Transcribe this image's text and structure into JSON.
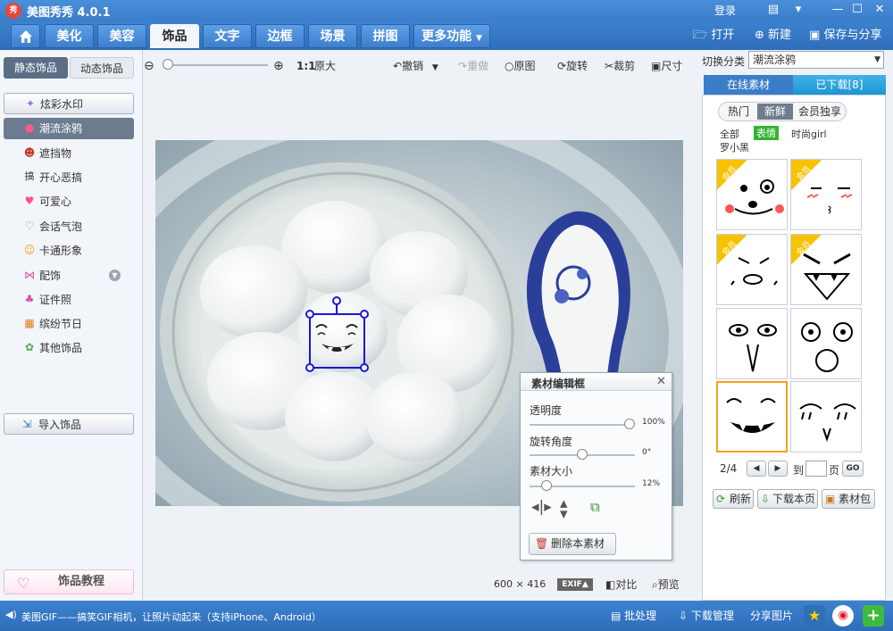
{
  "app": {
    "logo": "秀",
    "title": "美图秀秀 4.0.1",
    "login": "登录"
  },
  "tabs": [
    {
      "label": "美化"
    },
    {
      "label": "美容"
    },
    {
      "label": "饰品"
    },
    {
      "label": "文字"
    },
    {
      "label": "边框"
    },
    {
      "label": "场景"
    },
    {
      "label": "拼图"
    },
    {
      "label": "更多功能"
    }
  ],
  "top_actions": {
    "open": "打开",
    "new": "新建",
    "save": "保存与分享"
  },
  "left": {
    "subtabs": [
      "静态饰品",
      "动态饰品"
    ],
    "items": [
      {
        "label": "炫彩水印"
      },
      {
        "label": "潮流涂鸦"
      },
      {
        "label": "遮挡物"
      },
      {
        "label": "开心恶搞"
      },
      {
        "label": "可爱心"
      },
      {
        "label": "会话气泡"
      },
      {
        "label": "卡通形象"
      },
      {
        "label": "配饰"
      },
      {
        "label": "证件照"
      },
      {
        "label": "缤纷节日"
      },
      {
        "label": "其他饰品"
      }
    ],
    "import": "导入饰品",
    "tutorial": "饰品教程"
  },
  "toolbar": {
    "ratio": "1:1",
    "original_size": "原大",
    "undo": "撤销",
    "redo": "重做",
    "original": "原图",
    "rotate": "旋转",
    "crop": "裁剪",
    "resize": "尺寸"
  },
  "editor": {
    "title": "素材编辑框",
    "opacity_label": "透明度",
    "opacity_value": "100%",
    "opacity": 1.0,
    "rotate_label": "旋转角度",
    "rotate_value": "0°",
    "rotate": 0.5,
    "size_label": "素材大小",
    "size_value": "12%",
    "size": 0.12,
    "delete": "删除本素材"
  },
  "image_info": {
    "width": "600",
    "x": "×",
    "height": "416",
    "exif": "EXIF",
    "compare": "对比",
    "preview": "预览"
  },
  "right": {
    "switch_label": "切换分类",
    "category": "潮流涂鸦",
    "tabs": [
      "在线素材",
      "已下载[8]"
    ],
    "filters": [
      "热门",
      "新鲜",
      "会员独享"
    ],
    "tags": [
      "全部",
      "表情",
      "时尚girl",
      "罗小黑"
    ],
    "member_badge": "会员",
    "page": "2/4",
    "goto_prefix": "到",
    "goto_suffix": "页",
    "go": "GO",
    "refresh": "刷新",
    "download_page": "下载本页",
    "material_pack": "素材包"
  },
  "status": {
    "message": "美图GIF——搞笑GIF相机，让照片动起来（支持iPhone、Android）",
    "batch": "批处理",
    "download_mgr": "下载管理",
    "share": "分享图片"
  },
  "colors": {
    "accent": "#3b7dc8",
    "selected_green": "#2fb52f",
    "highlight": "#f5a020"
  }
}
